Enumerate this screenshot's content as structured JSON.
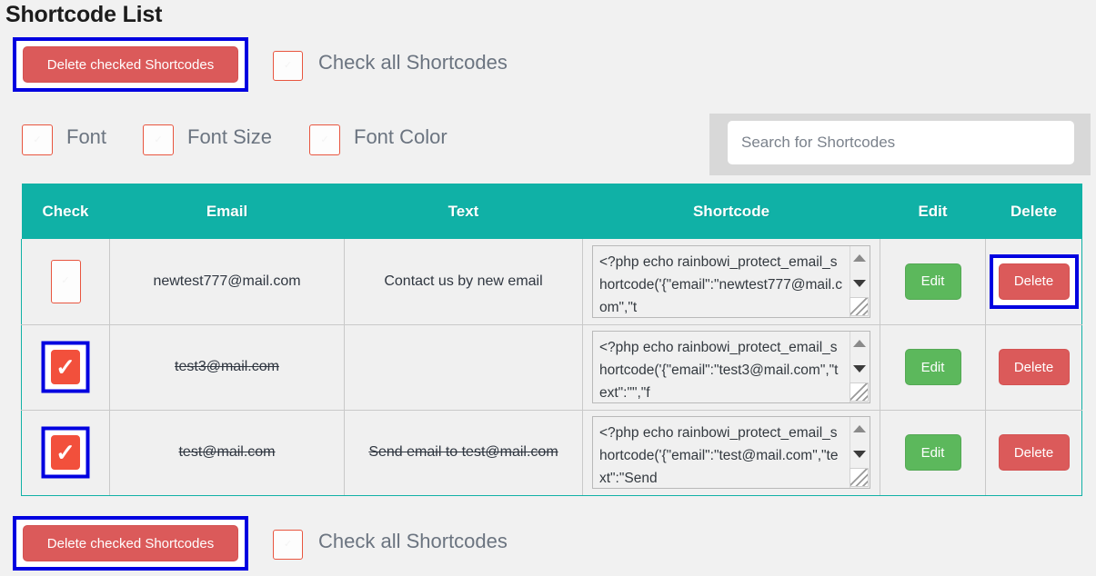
{
  "page_title": "Shortcode List",
  "toolbar_top": {
    "delete_checked_label": "Delete checked Shortcodes",
    "check_all_label": "Check all Shortcodes"
  },
  "toolbar_bottom": {
    "delete_checked_label": "Delete checked Shortcodes",
    "check_all_label": "Check all Shortcodes"
  },
  "filters": [
    {
      "label": "Font",
      "checked": false
    },
    {
      "label": "Font Size",
      "checked": false
    },
    {
      "label": "Font Color",
      "checked": false
    }
  ],
  "search": {
    "placeholder": "Search for Shortcodes",
    "value": ""
  },
  "table": {
    "columns": [
      "Check",
      "Email",
      "Text",
      "Shortcode",
      "Edit",
      "Delete"
    ],
    "rows": [
      {
        "checked": false,
        "email": "newtest777@mail.com",
        "text": "Contact us by new email",
        "strike": false,
        "shortcode": "<?php echo rainbowi_protect_email_shortcode('{\"email\":\"newtest777@mail.com\",\"t",
        "edit_label": "Edit",
        "delete_label": "Delete"
      },
      {
        "checked": true,
        "email": "test3@mail.com",
        "text": "",
        "strike": true,
        "shortcode": "<?php echo rainbowi_protect_email_shortcode('{\"email\":\"test3@mail.com\",\"text\":\"\",\"f",
        "edit_label": "Edit",
        "delete_label": "Delete"
      },
      {
        "checked": true,
        "email": "test@mail.com",
        "text": "Send email to test@mail.com",
        "strike": true,
        "shortcode": "<?php echo rainbowi_protect_email_shortcode('{\"email\":\"test@mail.com\",\"text\":\"Send",
        "edit_label": "Edit",
        "delete_label": "Delete"
      }
    ]
  },
  "colors": {
    "header_teal": "#10b1a6",
    "danger_red": "#db5a5a",
    "success_green": "#5cb85c",
    "checkbox_red": "#f2503c",
    "highlight_blue": "#0000e0",
    "page_bg": "#f1f1f1"
  },
  "glyphs": {
    "tick_unchecked": "✓",
    "tick_checked": "✓"
  }
}
